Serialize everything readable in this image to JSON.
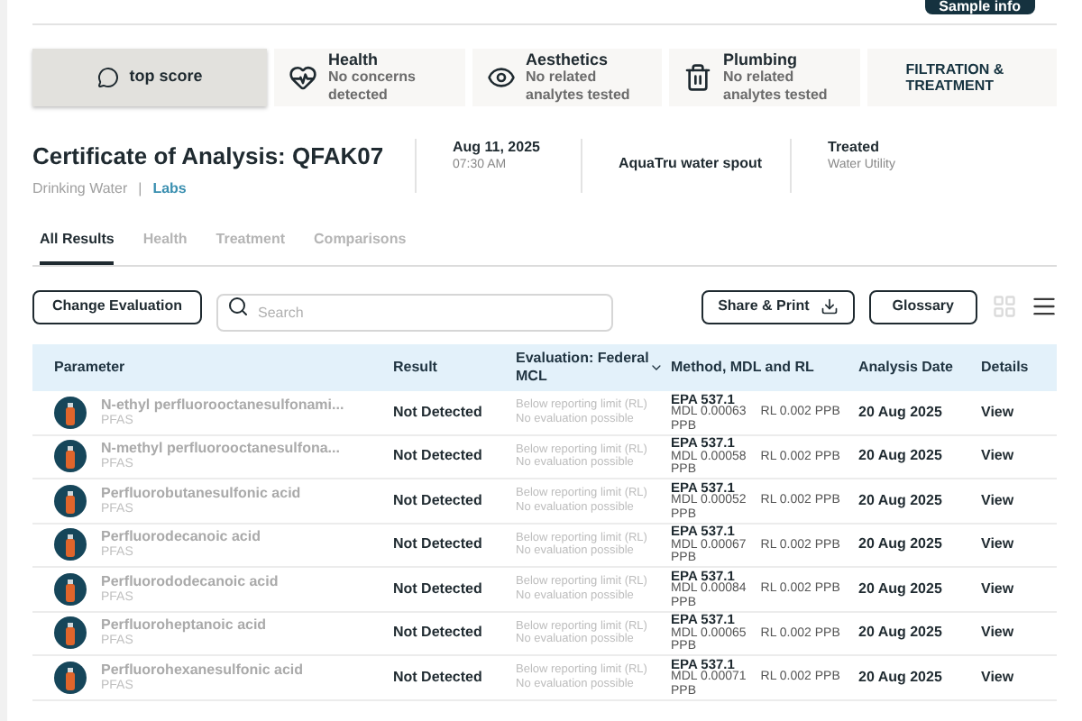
{
  "header": {
    "sample_button": "Sample info"
  },
  "score_cards": [
    {
      "kind": "score",
      "title": "top score",
      "selected": true
    },
    {
      "kind": "health",
      "title": "Health",
      "subtitle": "No concerns detected",
      "selected": false
    },
    {
      "kind": "aesthetics",
      "title": "Aesthetics",
      "subtitle": "No related analytes tested",
      "selected": false
    },
    {
      "kind": "plumbing",
      "title": "Plumbing",
      "subtitle": "No related analytes tested",
      "selected": false
    },
    {
      "kind": "link",
      "title": "FILTRATION & TREATMENT",
      "selected": false
    }
  ],
  "certificate": {
    "title": "Certificate of Analysis: QFAK07",
    "category": "Drinking Water",
    "separator": "|",
    "link": "Labs",
    "date": "Aug 11, 2025",
    "time": "07:30 AM",
    "source": "AquaTru water spout",
    "treatment": "Treated",
    "treatment_sub": "Water Utility"
  },
  "tabs": [
    {
      "label": "All Results",
      "selected": true
    },
    {
      "label": "Health",
      "selected": false
    },
    {
      "label": "Treatment",
      "selected": false
    },
    {
      "label": "Comparisons",
      "selected": false
    }
  ],
  "toolbar": {
    "change_button": "Change Evaluation",
    "search": {
      "placeholder": "Search"
    },
    "share_button": "Share & Print",
    "glossary_button": "Glossary",
    "view_modes": [
      {
        "kind": "grid",
        "selected": false
      },
      {
        "kind": "list",
        "selected": true
      }
    ]
  },
  "table": {
    "columns": [
      "Parameter",
      "Result",
      "Evaluation: Federal MCL",
      "Method, MDL and RL",
      "Analysis Date",
      "Details"
    ],
    "rows": [
      {
        "name": "N-ethyl perfluorooctanesulfonami...",
        "group": "PFAS",
        "result": "Not Detected",
        "eval": "Below reporting limit (RL)",
        "eval_note": "No evaluation possible",
        "method": "EPA 537.1",
        "mdl": "MDL 0.00063",
        "rl": "RL 0.002 PPB",
        "unit": "PPB",
        "date": "20 Aug 2025",
        "details": "View"
      },
      {
        "name": "N-methyl perfluorooctanesulfona...",
        "group": "PFAS",
        "result": "Not Detected",
        "eval": "Below reporting limit (RL)",
        "eval_note": "No evaluation possible",
        "method": "EPA 537.1",
        "mdl": "MDL 0.00058",
        "rl": "RL 0.002 PPB",
        "unit": "PPB",
        "date": "20 Aug 2025",
        "details": "View"
      },
      {
        "name": "Perfluorobutanesulfonic acid",
        "group": "PFAS",
        "result": "Not Detected",
        "eval": "Below reporting limit (RL)",
        "eval_note": "No evaluation possible",
        "method": "EPA 537.1",
        "mdl": "MDL 0.00052",
        "rl": "RL 0.002 PPB",
        "unit": "PPB",
        "date": "20 Aug 2025",
        "details": "View"
      },
      {
        "name": "Perfluorodecanoic acid",
        "group": "PFAS",
        "result": "Not Detected",
        "eval": "Below reporting limit (RL)",
        "eval_note": "No evaluation possible",
        "method": "EPA 537.1",
        "mdl": "MDL 0.00067",
        "rl": "RL 0.002 PPB",
        "unit": "PPB",
        "date": "20 Aug 2025",
        "details": "View"
      },
      {
        "name": "Perfluorododecanoic acid",
        "group": "PFAS",
        "result": "Not Detected",
        "eval": "Below reporting limit (RL)",
        "eval_note": "No evaluation possible",
        "method": "EPA 537.1",
        "mdl": "MDL 0.00084",
        "rl": "RL 0.002 PPB",
        "unit": "PPB",
        "date": "20 Aug 2025",
        "details": "View"
      },
      {
        "name": "Perfluoroheptanoic acid",
        "group": "PFAS",
        "result": "Not Detected",
        "eval": "Below reporting limit (RL)",
        "eval_note": "No evaluation possible",
        "method": "EPA 537.1",
        "mdl": "MDL 0.00065",
        "rl": "RL 0.002 PPB",
        "unit": "PPB",
        "date": "20 Aug 2025",
        "details": "View"
      },
      {
        "name": "Perfluorohexanesulfonic acid",
        "group": "PFAS",
        "result": "Not Detected",
        "eval": "Below reporting limit (RL)",
        "eval_note": "No evaluation possible",
        "method": "EPA 537.1",
        "mdl": "MDL 0.00071",
        "rl": "RL 0.002 PPB",
        "unit": "PPB",
        "date": "20 Aug 2025",
        "details": "View"
      }
    ]
  }
}
